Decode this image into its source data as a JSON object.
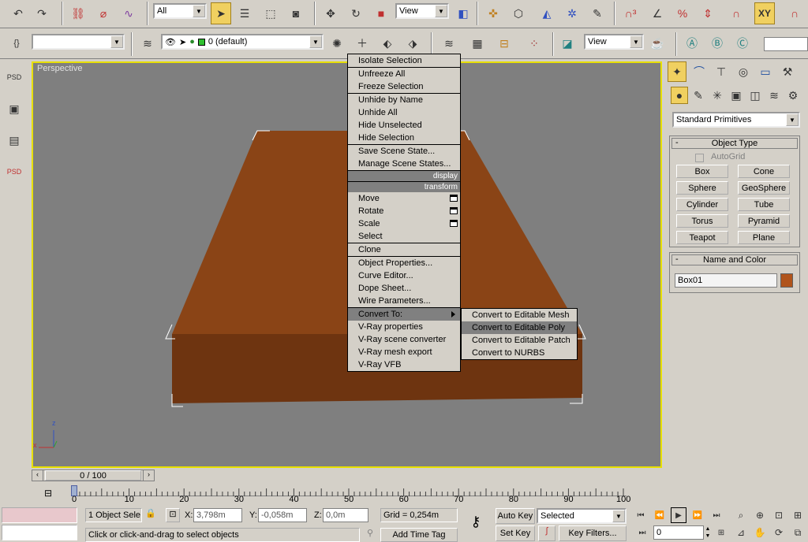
{
  "toolbar": {
    "selection_filter": "All",
    "ref_coord": "View",
    "named_selection": "",
    "layer": "0 (default)",
    "view2": "View"
  },
  "viewport": {
    "label": "Perspective",
    "axis_x": "x",
    "axis_z": "z"
  },
  "context_menu": {
    "items": [
      {
        "label": "Isolate Selection"
      },
      {
        "sep": true
      },
      {
        "label": "Unfreeze All"
      },
      {
        "label": "Freeze Selection"
      },
      {
        "sep": true
      },
      {
        "label": "Unhide by Name"
      },
      {
        "label": "Unhide All"
      },
      {
        "label": "Hide Unselected"
      },
      {
        "label": "Hide Selection"
      },
      {
        "sep": true
      },
      {
        "label": "Save Scene State..."
      },
      {
        "label": "Manage Scene States..."
      },
      {
        "header": "display"
      },
      {
        "header": "transform"
      },
      {
        "label": "Move",
        "box": true
      },
      {
        "label": "Rotate",
        "box": true
      },
      {
        "label": "Scale",
        "box": true
      },
      {
        "label": "Select"
      },
      {
        "sep": true
      },
      {
        "label": "Clone"
      },
      {
        "sep": true
      },
      {
        "label": "Object Properties..."
      },
      {
        "label": "Curve Editor..."
      },
      {
        "label": "Dope Sheet..."
      },
      {
        "label": "Wire Parameters..."
      },
      {
        "sep": true
      },
      {
        "label": "Convert To:",
        "submenu": true,
        "highlight": true
      },
      {
        "label": "V-Ray properties"
      },
      {
        "label": "V-Ray scene converter"
      },
      {
        "label": "V-Ray mesh export"
      },
      {
        "label": "V-Ray VFB"
      }
    ],
    "submenu": [
      {
        "label": "Convert to Editable Mesh"
      },
      {
        "label": "Convert to Editable Poly",
        "highlight": true
      },
      {
        "label": "Convert to Editable Patch"
      },
      {
        "label": "Convert to NURBS"
      }
    ]
  },
  "command_panel": {
    "category": "Standard Primitives",
    "object_type_title": "Object Type",
    "autogrid": "AutoGrid",
    "buttons": [
      "Box",
      "Cone",
      "Sphere",
      "GeoSphere",
      "Cylinder",
      "Tube",
      "Torus",
      "Pyramid",
      "Teapot",
      "Plane"
    ],
    "name_color_title": "Name and Color",
    "object_name": "Box01",
    "object_color": "#b0541c"
  },
  "timeline": {
    "frame": "0 / 100",
    "ticks": [
      "0",
      "10",
      "20",
      "30",
      "40",
      "50",
      "60",
      "70",
      "80",
      "90",
      "100"
    ]
  },
  "status": {
    "selection": "1 Object Sele",
    "x_label": "X:",
    "x_value": "3,798m",
    "y_label": "Y:",
    "y_value": "-0,058m",
    "z_label": "Z:",
    "z_value": "0,0m",
    "grid": "Grid = 0,254m",
    "prompt": "Click or click-and-drag to select objects",
    "add_time_tag": "Add Time Tag",
    "auto_key": "Auto Key",
    "set_key": "Set Key",
    "key_mode": "Selected",
    "key_filters": "Key Filters...",
    "current_frame": "0"
  },
  "colors": {
    "box_top": "#8a4416",
    "box_front": "#6e3410",
    "highlight": "#e8e000"
  }
}
